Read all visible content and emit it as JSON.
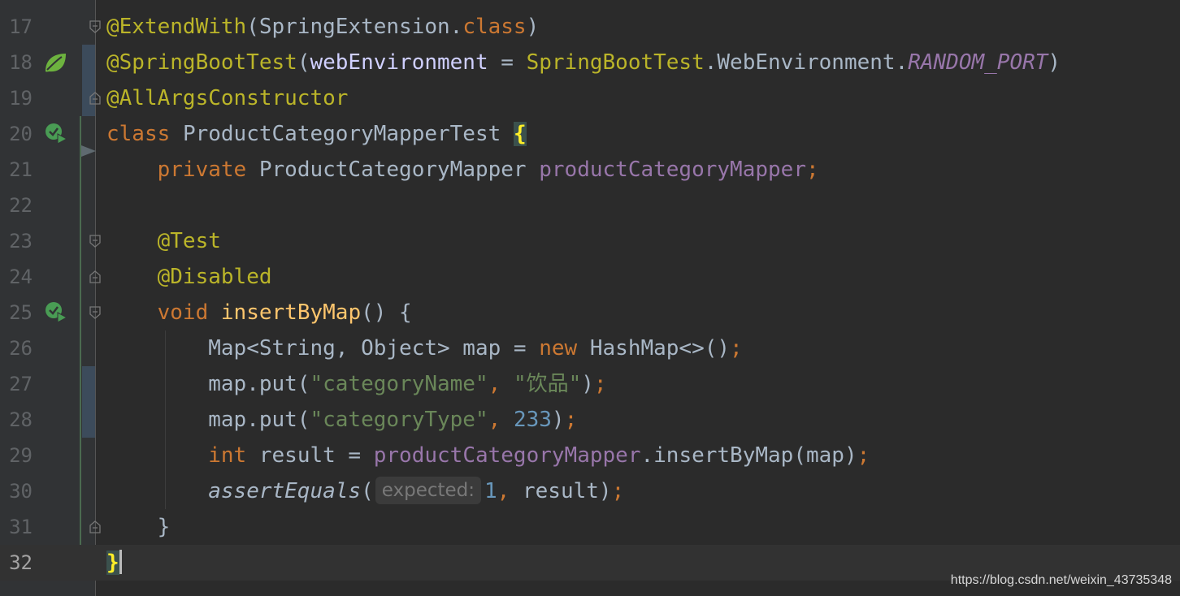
{
  "editor": {
    "lines": [
      {
        "n": "17"
      },
      {
        "n": "18"
      },
      {
        "n": "19"
      },
      {
        "n": "20"
      },
      {
        "n": "21"
      },
      {
        "n": "22"
      },
      {
        "n": "23"
      },
      {
        "n": "24"
      },
      {
        "n": "25"
      },
      {
        "n": "26"
      },
      {
        "n": "27"
      },
      {
        "n": "28"
      },
      {
        "n": "29"
      },
      {
        "n": "30"
      },
      {
        "n": "31"
      },
      {
        "n": "32"
      }
    ],
    "tokens": {
      "extendWith": "@ExtendWith",
      "springExtension": "SpringExtension",
      "classKw": "class",
      "springBootTest": "@SpringBootTest",
      "webEnvironment": "webEnvironment",
      "springBootTestRef": "SpringBootTest",
      "webEnvironmentEnum": "WebEnvironment",
      "randomPort": "RANDOM_PORT",
      "allArgs": "@AllArgsConstructor",
      "className": "ProductCategoryMapperTest",
      "privateKw": "private",
      "mapperType": "ProductCategoryMapper",
      "mapperField": "productCategoryMapper",
      "testAnn": "@Test",
      "disabledAnn": "@Disabled",
      "voidKw": "void",
      "methodName": "insertByMap",
      "mapDecl": "Map<String, Object> map = ",
      "newKw": "new",
      "hashMap": " HashMap<>()",
      "mapPut": "map.put(",
      "strCategoryName": "\"categoryName\"",
      "strDrink": "\"饮品\"",
      "strCategoryType": "\"categoryType\"",
      "num233": "233",
      "intKw": "int",
      "resultAssign": " result = ",
      "insertCall": ".insertByMap(map)",
      "assertEquals": "assertEquals",
      "hintExpected": "expected:",
      "num1": "1",
      "resultArg": " result)"
    }
  },
  "watermark": "https://blog.csdn.net/weixin_43735348",
  "colors": {
    "background": "#2b2b2b",
    "keyword": "#cc7832",
    "annotation": "#bbb529",
    "string": "#6a8759",
    "number": "#6897bb",
    "field": "#9876aa",
    "method": "#ffc66d"
  },
  "icons": [
    "spring-bean-icon",
    "run-test-icon",
    "fold-marker-icon"
  ]
}
